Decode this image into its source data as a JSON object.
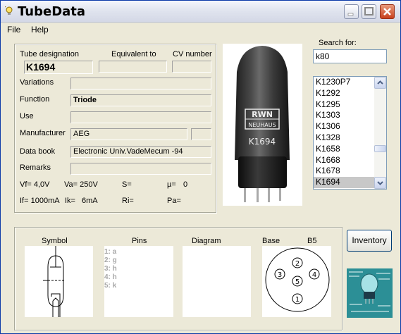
{
  "window": {
    "title": "TubeData"
  },
  "menu": {
    "file": "File",
    "help": "Help"
  },
  "fields": {
    "tube_designation_label": "Tube designation",
    "equivalent_label": "Equivalent to",
    "cv_label": "CV number",
    "tube_designation": "K1694",
    "equivalent": "",
    "cv_number": "",
    "variations_label": "Variations",
    "variations": "",
    "function_label": "Function",
    "function": "Triode",
    "use_label": "Use",
    "use": "",
    "manufacturer_label": "Manufacturer",
    "manufacturer": "AEG",
    "manufacturer_extra": "",
    "databook_label": "Data book",
    "databook": "Electronic Univ.VadeMecum -94",
    "remarks_label": "Remarks",
    "remarks": ""
  },
  "params": {
    "vf": "Vf= 4,0V",
    "va": "Va= 250V",
    "s": "S=",
    "mu": "µ=",
    "mu_val": "0",
    "if": "If= 1000mA",
    "ik": "Ik=",
    "ik_val": "6mA",
    "ri": "Ri=",
    "pa": "Pa="
  },
  "search": {
    "label": "Search for:",
    "value": "k80"
  },
  "list": {
    "items": [
      "K1230P7",
      "K1292",
      "K1295",
      "K1303",
      "K1306",
      "K1328",
      "K1658",
      "K1668",
      "K1678",
      "K1694"
    ],
    "selected": "K1694"
  },
  "photo": {
    "brand_top": "RWN",
    "brand_bottom": "NEUHAUS",
    "label": "K1694"
  },
  "bottom": {
    "symbol_label": "Symbol",
    "pins_label": "Pins",
    "diagram_label": "Diagram",
    "base_label": "Base",
    "base_type": "B5",
    "pins": [
      "1: a",
      "2: g",
      "3: h",
      "4: h",
      "5: k"
    ],
    "base_pins": [
      "1",
      "2",
      "3",
      "4",
      "5"
    ]
  },
  "buttons": {
    "inventory": "Inventory"
  }
}
